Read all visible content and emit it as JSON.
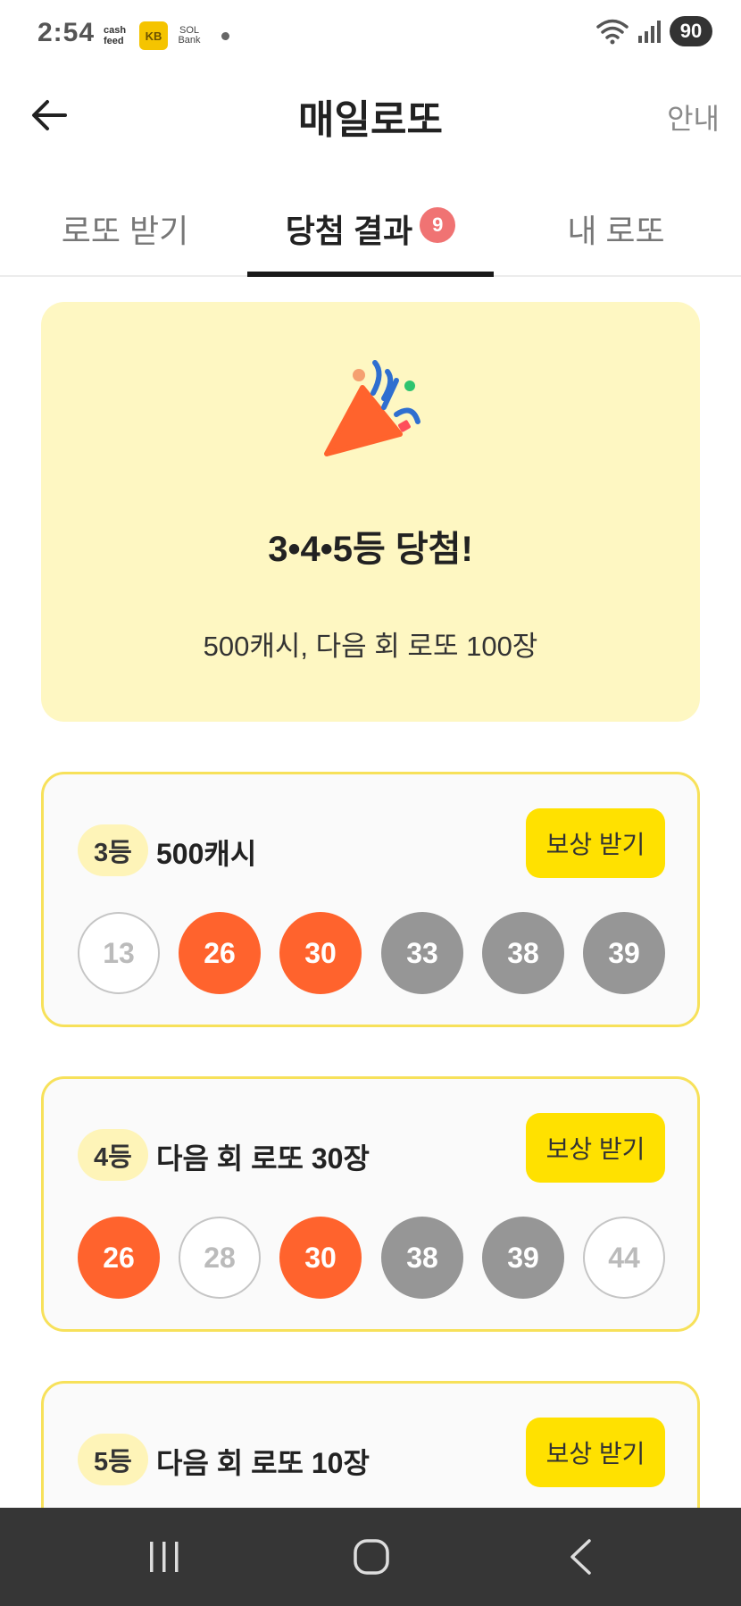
{
  "status_bar": {
    "time": "2:54",
    "notif_cash": "cash feed",
    "notif_kb": "KB",
    "notif_sol": "SOL Bank",
    "battery": "90"
  },
  "header": {
    "title": "매일로또",
    "guide": "안내"
  },
  "tabs": [
    {
      "label": "로또 받기"
    },
    {
      "label": "당첨 결과",
      "badge": "9"
    },
    {
      "label": "내 로또"
    }
  ],
  "hero": {
    "title": "3•4•5등 당첨!",
    "subtitle": "500캐시, 다음 회 로또 100장"
  },
  "cards": [
    {
      "rank": "3등",
      "prize": "500캐시",
      "button": "보상 받기",
      "balls": [
        {
          "n": "13",
          "state": "miss"
        },
        {
          "n": "26",
          "state": "hit"
        },
        {
          "n": "30",
          "state": "hit"
        },
        {
          "n": "33",
          "state": "gray"
        },
        {
          "n": "38",
          "state": "gray"
        },
        {
          "n": "39",
          "state": "gray"
        }
      ]
    },
    {
      "rank": "4등",
      "prize": "다음 회 로또 30장",
      "button": "보상 받기",
      "balls": [
        {
          "n": "26",
          "state": "hit"
        },
        {
          "n": "28",
          "state": "miss"
        },
        {
          "n": "30",
          "state": "hit"
        },
        {
          "n": "38",
          "state": "gray"
        },
        {
          "n": "39",
          "state": "gray"
        },
        {
          "n": "44",
          "state": "miss"
        }
      ]
    },
    {
      "rank": "5등",
      "prize": "다음 회 로또 10장",
      "button": "보상 받기"
    }
  ],
  "nav": {
    "recent_icon": "recent-apps-icon",
    "home_icon": "home-icon",
    "back_icon": "back-icon"
  },
  "colors": {
    "hit": "#ff632d",
    "gray": "#969696",
    "accent_yellow": "#ffe100",
    "hero_bg": "#fef7c2",
    "badge": "#f07373"
  }
}
